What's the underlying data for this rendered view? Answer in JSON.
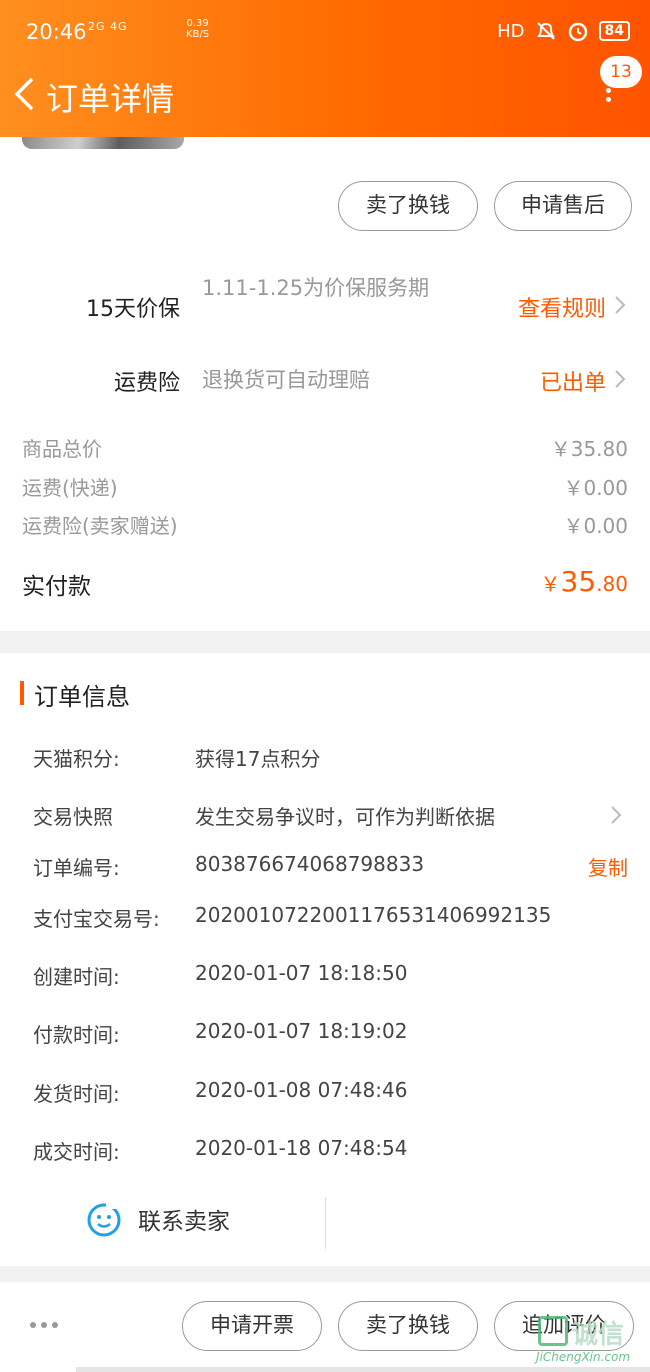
{
  "status_bar": {
    "time": "20:46",
    "network": "2G 4G",
    "speed": "0.39",
    "speed_unit": "KB/S",
    "hd": "HD",
    "battery": "84"
  },
  "header": {
    "title": "订单详情",
    "badge": "13"
  },
  "top_actions": {
    "sell_label": "卖了换钱",
    "after_sale_label": "申请售后"
  },
  "services": [
    {
      "name": "15天价保",
      "desc": "1.11-1.25为价保服务期",
      "link": "查看规则"
    },
    {
      "name": "运费险",
      "desc": "退换货可自动理赔",
      "link": "已出单"
    }
  ],
  "prices": [
    {
      "label": "商品总价",
      "value": "￥35.80"
    },
    {
      "label": "运费(快递)",
      "value": "￥0.00"
    },
    {
      "label": "运费险(卖家赠送)",
      "value": "￥0.00"
    }
  ],
  "paid": {
    "label": "实付款",
    "currency": "￥",
    "integer": "35",
    "decimal": ".80"
  },
  "order_info": {
    "title": "订单信息",
    "rows": [
      {
        "label": "天猫积分:",
        "value": "获得17点积分"
      },
      {
        "label": "交易快照",
        "value": "发生交易争议时，可作为判断依据"
      },
      {
        "label": "订单编号:",
        "value": "803876674068798833",
        "action": "复制"
      },
      {
        "label": "支付宝交易号:",
        "value": "2020010722001176531406992135"
      },
      {
        "label": "创建时间:",
        "value": "2020-01-07 18:18:50"
      },
      {
        "label": "付款时间:",
        "value": "2020-01-07 18:19:02"
      },
      {
        "label": "发货时间:",
        "value": "2020-01-08 07:48:46"
      },
      {
        "label": "成交时间:",
        "value": "2020-01-18 07:48:54"
      }
    ],
    "contact_label": "联系卖家"
  },
  "bottom_bar": {
    "invoice_label": "申请开票",
    "sell_label": "卖了换钱",
    "review_label": "追加评价"
  },
  "watermark": {
    "text": "诚信",
    "url": "JiChengXin.com"
  },
  "colors": {
    "accent": "#ff5a00",
    "header_start": "#ff8f1f",
    "header_end": "#ff5300"
  }
}
